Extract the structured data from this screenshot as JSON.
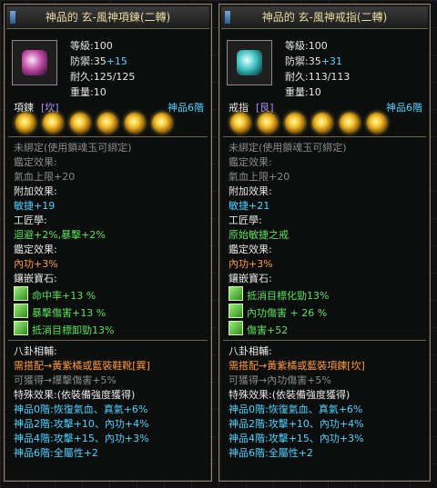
{
  "left": {
    "title": "神品的 玄-風神項鍊(二轉)",
    "stats": {
      "level": "等級:100",
      "defense_label": "防禦:35",
      "defense_bonus": "+15",
      "durability": "耐久:125/125",
      "weight": "重量:10"
    },
    "socket": {
      "label": "項鍊",
      "type": "[坎]",
      "grade": "神品6階"
    },
    "lines": [
      {
        "text": "未綁定(使用鎖魂玉可綁定)",
        "cls": "dim"
      },
      {
        "text": "鑑定效果:",
        "cls": "dim"
      },
      {
        "text": "氣血上限+20",
        "cls": "dim"
      },
      {
        "text": "附加效果:",
        "cls": "white"
      },
      {
        "text": "敏捷+19",
        "cls": "blue"
      },
      {
        "text": "工匠學:",
        "cls": "white"
      },
      {
        "text": "迴避+2%,暴擊+2%",
        "cls": "green"
      },
      {
        "text": "鑑定效果:",
        "cls": "white"
      },
      {
        "text": "內功+3%",
        "cls": "orange"
      },
      {
        "text": "鑲嵌寶石:",
        "cls": "white"
      }
    ],
    "gems": [
      "命中率+13 %",
      "暴擊傷害+13 %",
      "抵消目標卸勁13%"
    ],
    "section2": [
      {
        "text": "八卦相輔:",
        "cls": "white"
      },
      {
        "text": "需搭配→黃紫橘或藍裝鞋靴[巽]",
        "cls": "orange"
      },
      {
        "text": "可獲得→爆擊傷害+5%",
        "cls": "dim"
      },
      {
        "text": "特殊效果:(依裝備強度獲得)",
        "cls": "white"
      },
      {
        "text": "神品0階:恢復氣血、真氣+6%",
        "cls": "blue"
      },
      {
        "text": "神品2階:攻擊+10、內功+4%",
        "cls": "blue"
      },
      {
        "text": "神品4階:攻擊+15、內功+3%",
        "cls": "blue"
      },
      {
        "text": "神品6階:全屬性+2",
        "cls": "blue"
      }
    ]
  },
  "right": {
    "title": "神品的 玄-風神戒指(二轉)",
    "stats": {
      "level": "等級:100",
      "defense_label": "防禦:35",
      "defense_bonus": "+31",
      "durability": "耐久:113/113",
      "weight": "重量:10"
    },
    "socket": {
      "label": "戒指",
      "type": "[艮]",
      "grade": "神品6階"
    },
    "lines": [
      {
        "text": "未綁定(使用鎖魂玉可綁定)",
        "cls": "dim"
      },
      {
        "text": "鑑定效果:",
        "cls": "dim"
      },
      {
        "text": "氣血上限+20",
        "cls": "dim"
      },
      {
        "text": "附加效果:",
        "cls": "white"
      },
      {
        "text": "敏捷+21",
        "cls": "blue"
      },
      {
        "text": "工匠學:",
        "cls": "white"
      },
      {
        "text": "原始敏捷之戒",
        "cls": "green"
      },
      {
        "text": "鑑定效果:",
        "cls": "white"
      },
      {
        "text": "內功+3%",
        "cls": "orange"
      },
      {
        "text": "鑲嵌寶石:",
        "cls": "white"
      }
    ],
    "gems": [
      "抵消目標化勁13%",
      "內功傷害 + 26 %",
      "傷害+52"
    ],
    "section2": [
      {
        "text": "八卦相輔:",
        "cls": "white"
      },
      {
        "text": "需搭配→黃紫橘或藍裝項鍊[坎]",
        "cls": "orange"
      },
      {
        "text": "可獲得→內功傷害+5%",
        "cls": "dim"
      },
      {
        "text": "特殊效果:(依裝備強度獲得)",
        "cls": "white"
      },
      {
        "text": "神品0階:恢復氣血、真氣+6%",
        "cls": "blue"
      },
      {
        "text": "神品2階:攻擊+10、內功+4%",
        "cls": "blue"
      },
      {
        "text": "神品4階:攻擊+15、內功+3%",
        "cls": "blue"
      },
      {
        "text": "神品6階:全屬性+2",
        "cls": "blue"
      }
    ]
  }
}
